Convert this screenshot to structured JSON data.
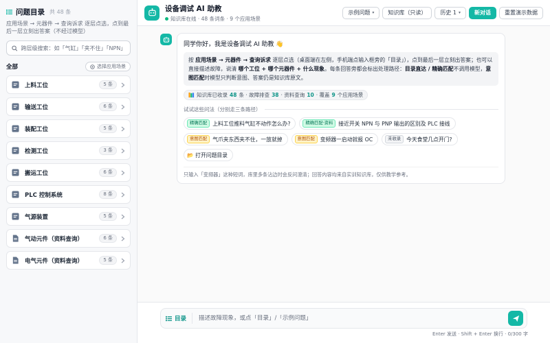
{
  "sidebar": {
    "title": "问题目录",
    "count": "共 48 条",
    "description": "应用场景 → 元器件 → 查询诉求 逐层点选，点到最后一层立刻出答案（不经过模型）",
    "search_placeholder": "跨层级搜索：如「气缸」「夹不住」「NPN」",
    "filter_label": "全部",
    "select_scene": "选择应用场景",
    "items": [
      {
        "label": "上料工位",
        "badge": "5 条",
        "icon": "chip-icon"
      },
      {
        "label": "输送工位",
        "badge": "6 条",
        "icon": "chip-icon"
      },
      {
        "label": "装配工位",
        "badge": "5 条",
        "icon": "chip-icon"
      },
      {
        "label": "检测工位",
        "badge": "3 条",
        "icon": "chip-icon"
      },
      {
        "label": "搬运工位",
        "badge": "6 条",
        "icon": "chip-icon"
      },
      {
        "label": "PLC 控制系统",
        "badge": "8 条",
        "icon": "chip-icon"
      },
      {
        "label": "气源装置",
        "badge": "5 条",
        "icon": "chip-icon"
      },
      {
        "label": "气动元件（资料查询）",
        "badge": "6 条",
        "icon": "document-icon"
      },
      {
        "label": "电气元件（资料查询）",
        "badge": "5 条",
        "icon": "document-icon"
      }
    ]
  },
  "header": {
    "title": "设备调试 AI 助教",
    "status": "知识库在线 · 48 条词条 · 9 个应用场景",
    "buttons": {
      "examples": "示例问题",
      "kb": "知识库（只读）",
      "history": "历史 1",
      "new_chat": "新对话",
      "reset": "重置演示数据"
    }
  },
  "message": {
    "greeting": "同学你好，我是设备调试 AI 助教 👋",
    "info": {
      "p1": "按 ",
      "b1": "应用场景 → 元器件 → 查询诉求",
      "p2": " 逐层点选（桌面端在左侧，手机端点输入框旁的「目录」），点到最后一层立刻出答案；也可以直接描述故障，说清 ",
      "b2": "哪个工位 + 哪个元器件 + 什么现象",
      "p3": "。每条回答旁都会标出处理路径：",
      "b3": "目录直达 / 精确匹配",
      "p4": "不调用模型，",
      "b4": "意图匹配",
      "p5": "时模型只判断意图、答案仍是知识库原文。"
    },
    "stats": {
      "p1": "知识库已收录 ",
      "n1": "48",
      "p2": " 条 · 故障排查 ",
      "n2": "38",
      "p3": " · 资料查询 ",
      "n3": "10",
      "p4": " · 覆盖 ",
      "n4": "9",
      "p5": " 个应用场景"
    },
    "try_label": "试试这些问法（分别走三条路径）",
    "chips": [
      {
        "tag": "精确匹配",
        "tag_color": "green",
        "text": "上料工位推料气缸不动作怎么办?"
      },
      {
        "tag": "精确匹配·资料",
        "tag_color": "green",
        "text": "接近开关 NPN 与 PNP 输出的区别及 PLC 接线"
      },
      {
        "tag": "意图匹配",
        "tag_color": "orange",
        "text": "气爪夹东西夹不住，一放就掉"
      },
      {
        "tag": "意图匹配",
        "tag_color": "orange",
        "text": "变频器一启动就报 OC"
      },
      {
        "tag": "未收录",
        "tag_color": "gray",
        "text": "今天食堂几点开门?"
      },
      {
        "tag": "",
        "tag_color": "",
        "text": "📂 打开问题目录"
      }
    ],
    "note": "只输入「变频器」这种短词，库里多条沾边时会反问澄清；回答内容均来自实训知识库，仅供教学参考。"
  },
  "composer": {
    "dir_label": "目录",
    "placeholder": "描述故障现象，或点「目录」/「示例问题」",
    "hint": "Enter 发送 · Shift + Enter 换行 · 0/300 字"
  },
  "colors": {
    "accent": "#14b8a6",
    "online": "#10b981"
  }
}
